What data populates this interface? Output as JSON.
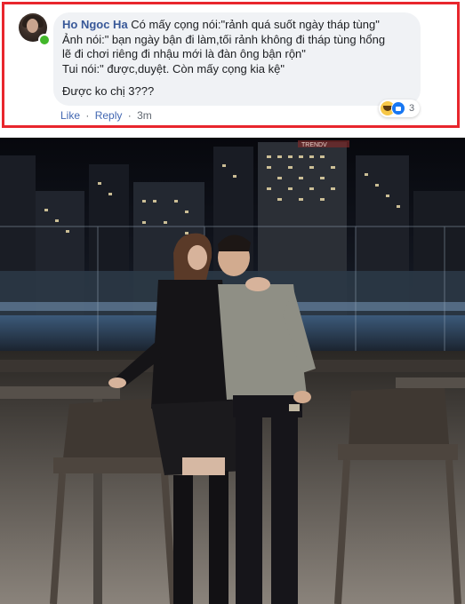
{
  "comment": {
    "author": "Ho Ngoc Ha",
    "lines": [
      "Có mấy cọng nói:\"rảnh quá suốt ngày tháp tùng\"",
      "Ảnh nói:\" bạn ngày bận đi làm,tối rảnh không đi tháp tùng hổng",
      "lẽ đi chơi riêng đi nhậu mới là đàn ông bận rộn\"",
      "Tui nói:\" được,duyệt. Còn mấy cọng kia kệ\"",
      "Được ko chị 3???"
    ],
    "actions": {
      "like": "Like",
      "reply": "Reply",
      "separator": "·",
      "time": "3m"
    },
    "reactions": {
      "count": "3",
      "icons": [
        "haha-reaction-icon",
        "like-reaction-icon"
      ]
    },
    "highlight_color": "#e8262d"
  },
  "photo": {
    "subject": "couple-photo-rooftop-night",
    "sign_text": "TRENDV"
  }
}
